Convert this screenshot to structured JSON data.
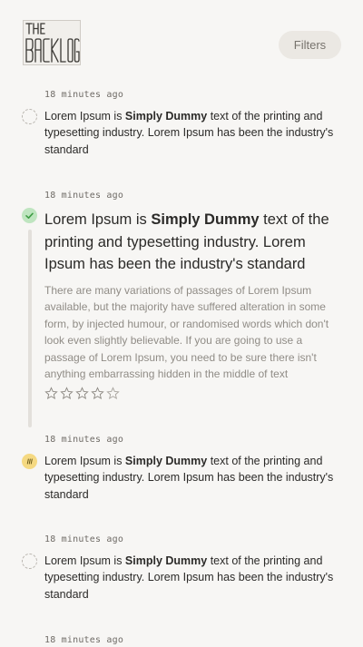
{
  "app": {
    "logo_text": "THE BACKLOG"
  },
  "header": {
    "filters_label": "Filters"
  },
  "feed": {
    "items": [
      {
        "time": "18 minutes ago",
        "status": "pending",
        "title_pre": "Lorem Ipsum is ",
        "title_bold": "Simply Dummy",
        "title_post": " text of the printing and typesetting industry. Lorem Ipsum has been the industry's standard"
      },
      {
        "time": "18 minutes ago",
        "status": "done",
        "title_pre": "Lorem Ipsum is ",
        "title_bold": "Simply Dummy",
        "title_post": " text of the printing and typesetting industry. Lorem Ipsum has been the industry's standard",
        "description": "There are many variations of passages of Lorem Ipsum available, but the majority have suffered alteration in some form, by injected humour, or randomised words which don't look even slightly believable. If you are going to use a passage of Lorem Ipsum, you need to be sure there isn't anything embarrassing hidden in the middle of text",
        "rating": 0,
        "rating_max": 5
      },
      {
        "time": "18 minutes ago",
        "status": "in-progress",
        "title_pre": "Lorem Ipsum is ",
        "title_bold": "Simply Dummy",
        "title_post": " text of the printing and typesetting industry. Lorem Ipsum has been the industry's standard"
      },
      {
        "time": "18 minutes ago",
        "status": "pending",
        "title_pre": "Lorem Ipsum is ",
        "title_bold": "Simply Dummy",
        "title_post": " text of the printing and typesetting industry. Lorem Ipsum has been the industry's standard"
      },
      {
        "time": "18 minutes ago"
      }
    ]
  },
  "colors": {
    "background": "#f7f6f4",
    "done": "#bfe5c0",
    "done_check": "#3f9d45",
    "in_progress": "#f5d982",
    "pending_border": "#b9b5af"
  },
  "icons": {
    "pending": "dashed-circle-icon",
    "done": "check-circle-icon",
    "in_progress": "progress-circle-icon",
    "rating": "star-outline-icon"
  }
}
